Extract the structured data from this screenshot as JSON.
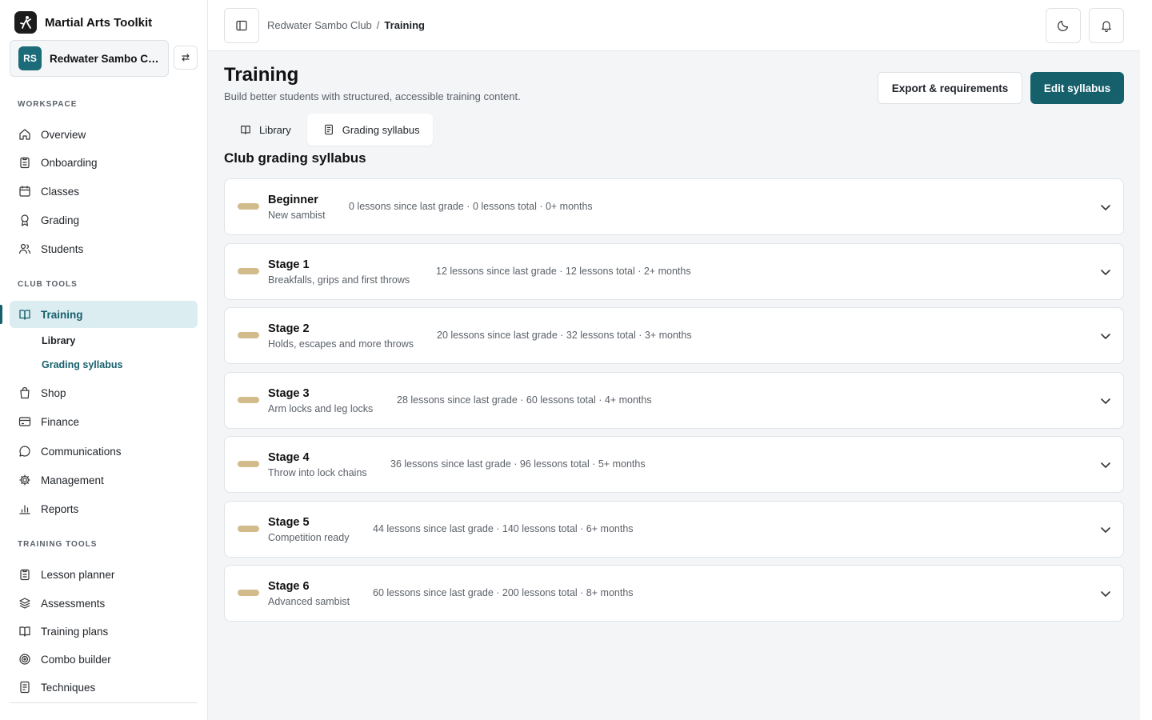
{
  "app": {
    "name": "Martial Arts Toolkit"
  },
  "club": {
    "initials": "RS",
    "name": "Redwater Sambo Club"
  },
  "sidebar": {
    "sections": {
      "workspace": "WORKSPACE",
      "club_tools": "CLUB TOOLS",
      "training_tools": "TRAINING TOOLS"
    },
    "workspace_items": [
      {
        "label": "Overview",
        "icon": "home-icon"
      },
      {
        "label": "Onboarding",
        "icon": "clipboard-icon"
      },
      {
        "label": "Classes",
        "icon": "calendar-icon"
      },
      {
        "label": "Grading",
        "icon": "award-icon"
      },
      {
        "label": "Students",
        "icon": "users-icon"
      }
    ],
    "club_items": [
      {
        "label": "Training",
        "icon": "book-open-icon",
        "active": true
      },
      {
        "label": "Shop",
        "icon": "shopping-bag-icon"
      },
      {
        "label": "Finance",
        "icon": "credit-card-icon"
      },
      {
        "label": "Communications",
        "icon": "message-icon"
      },
      {
        "label": "Management",
        "icon": "gear-icon"
      },
      {
        "label": "Reports",
        "icon": "bar-chart-icon"
      }
    ],
    "training_subitems": [
      {
        "label": "Library",
        "active": false
      },
      {
        "label": "Grading syllabus",
        "active": true
      }
    ],
    "training_tool_items": [
      {
        "label": "Lesson planner",
        "icon": "clipboard-icon"
      },
      {
        "label": "Assessments",
        "icon": "layers-icon"
      },
      {
        "label": "Training plans",
        "icon": "book-open-icon"
      },
      {
        "label": "Combo builder",
        "icon": "target-icon"
      },
      {
        "label": "Techniques",
        "icon": "document-icon"
      }
    ]
  },
  "breadcrumb": {
    "parent": "Redwater Sambo Club",
    "separator": "/",
    "current": "Training"
  },
  "page": {
    "title": "Training",
    "subtitle": "Build better students with structured, accessible training content.",
    "export_label": "Export & requirements",
    "edit_label": "Edit syllabus",
    "tabs": [
      {
        "label": "Library",
        "icon": "book-open-icon",
        "active": false
      },
      {
        "label": "Grading syllabus",
        "icon": "document-icon",
        "active": true
      }
    ],
    "section_title": "Club grading syllabus"
  },
  "colors": {
    "accent": "#16606c",
    "belt": "#d2bc8c",
    "active_nav_bg": "#dcedf1"
  },
  "grades": [
    {
      "name": "Beginner",
      "description": "New sambist",
      "meta": "0 lessons since last grade · 0 lessons total · 0+ months"
    },
    {
      "name": "Stage 1",
      "description": "Breakfalls, grips and first throws",
      "meta": "12 lessons since last grade · 12 lessons total · 2+ months"
    },
    {
      "name": "Stage 2",
      "description": "Holds, escapes and more throws",
      "meta": "20 lessons since last grade · 32 lessons total · 3+ months"
    },
    {
      "name": "Stage 3",
      "description": "Arm locks and leg locks",
      "meta": "28 lessons since last grade · 60 lessons total · 4+ months"
    },
    {
      "name": "Stage 4",
      "description": "Throw into lock chains",
      "meta": "36 lessons since last grade · 96 lessons total · 5+ months"
    },
    {
      "name": "Stage 5",
      "description": "Competition ready",
      "meta": "44 lessons since last grade · 140 lessons total · 6+ months"
    },
    {
      "name": "Stage 6",
      "description": "Advanced sambist",
      "meta": "60 lessons since last grade · 200 lessons total · 8+ months"
    }
  ]
}
